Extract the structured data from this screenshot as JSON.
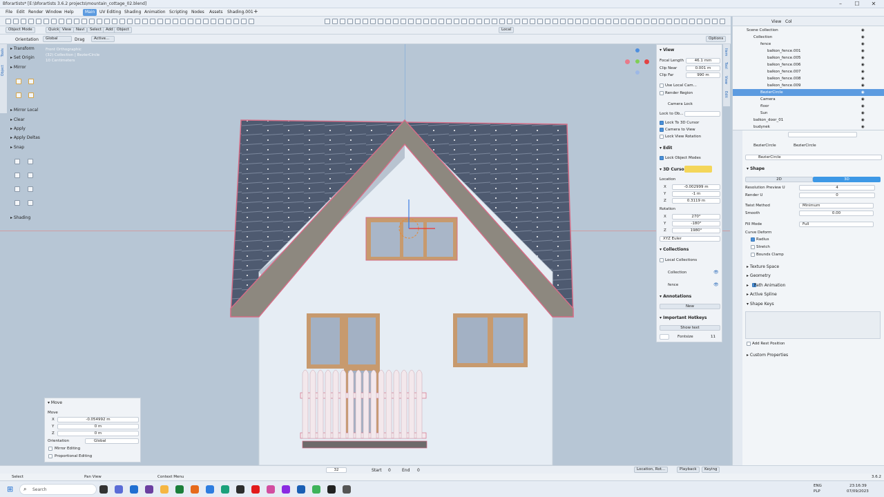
{
  "window": {
    "title": "Bforartists* [E:\\bforartists 3.6.2 projects\\mountain_cottage_02.blend]"
  },
  "top_menu": {
    "items": [
      "File",
      "Edit",
      "Render",
      "Window",
      "Help"
    ],
    "tabs": [
      "Main",
      "UV Editing",
      "Shading",
      "Animation",
      "Scripting",
      "Nodes",
      "Assets",
      "Shading.001"
    ],
    "active_tab": "Main"
  },
  "viewport_header": {
    "mode": "Object Mode",
    "buttons": [
      "Quick",
      "View",
      "Navi",
      "Select",
      "Add",
      "Object"
    ],
    "local": "Local",
    "options": "Options"
  },
  "tool_header": {
    "orientation_label": "Orientation",
    "orientation_value": "Global",
    "drag_label": "Drag",
    "drag_value": "Active..."
  },
  "viewport_info": {
    "line1": "Front Orthographic",
    "line2": "(32) Collection | BezierCircle",
    "line3": "10 Centimeters"
  },
  "left_toolbar": {
    "tabs": [
      "Tools",
      "Object"
    ],
    "items": [
      "Transform",
      "Set Origin",
      "Mirror",
      "Mirror Local",
      "Clear",
      "Apply",
      "Apply Deltas",
      "Snap",
      "Shading"
    ]
  },
  "move_panel": {
    "title": "Move",
    "section": "Move",
    "x": "-0.054992 m",
    "y": "0 m",
    "z": "0 m",
    "orientation_label": "Orientation",
    "orientation_value": "Global",
    "mirror_editing": "Mirror Editing",
    "proportional_editing": "Proportional Editing"
  },
  "n_panel": {
    "tabs": [
      "Item",
      "Tool",
      "View",
      "Edit"
    ],
    "view_title": "View",
    "focal_length_label": "Focal Length",
    "focal_length": "46.1 mm",
    "clip_near_label": "Clip Near",
    "clip_near": "0.001 m",
    "clip_far_label": "Clip Far",
    "clip_far": "990 m",
    "use_local_cam": "Use Local Cam...",
    "render_region": "Render Region",
    "camera_lock": "Camera Lock",
    "lock_to_obj": "Lock to Ob...",
    "lock_3d_cursor": "Lock To 3D Cursor",
    "camera_to_view": "Camera to View",
    "lock_view_rotation": "Lock View Rotation",
    "edit_title": "Edit",
    "lock_object_modes": "Lock Object Modes",
    "cursor_title": "3D Cursor",
    "location_label": "Location",
    "loc_x": "-0.002999 m",
    "loc_y": "-1 m",
    "loc_z": "0.3119 m",
    "rotation_label": "Rotation",
    "rot_x": "270°",
    "rot_y": "-180°",
    "rot_z": "1980°",
    "rot_mode": "XYZ Euler",
    "collections_title": "Collections",
    "local_collections": "Local Collections",
    "collection": "Collection",
    "fence": "fence",
    "annotations_title": "Annotations",
    "new_btn": "New",
    "hotkeys_title": "Important Hotkeys",
    "show_text": "Show text",
    "fontsize_label": "Fontsize",
    "fontsize": "11"
  },
  "outliner": {
    "header_view": "View",
    "header_col": "Col",
    "rows": [
      {
        "label": "Scene Collection",
        "indent": 0
      },
      {
        "label": "Collection",
        "indent": 1
      },
      {
        "label": "fence",
        "indent": 2
      },
      {
        "label": "balkon_fence.001",
        "indent": 3
      },
      {
        "label": "balkon_fence.005",
        "indent": 3
      },
      {
        "label": "balkon_fence.006",
        "indent": 3
      },
      {
        "label": "balkon_fence.007",
        "indent": 3
      },
      {
        "label": "balkon_fence.008",
        "indent": 3
      },
      {
        "label": "balkon_fence.009",
        "indent": 3
      },
      {
        "label": "BezierCircle",
        "indent": 2
      },
      {
        "label": "Camera",
        "indent": 2
      },
      {
        "label": "floor",
        "indent": 2
      },
      {
        "label": "Sun",
        "indent": 2
      },
      {
        "label": "balkon_door_01",
        "indent": 1
      },
      {
        "label": "budynek",
        "indent": 1
      }
    ],
    "selected": "BezierCircle"
  },
  "properties": {
    "object_name": "BezierCircle",
    "data_name": "BezierCircle",
    "datablock": "BezierCircle",
    "shape_title": "Shape",
    "dim_2d": "2D",
    "dim_3d": "3D",
    "res_preview_label": "Resolution Preview U",
    "res_preview": "4",
    "render_u_label": "Render U",
    "render_u": "0",
    "twist_method_label": "Twist Method",
    "twist_method": "Minimum",
    "smooth_label": "Smooth",
    "smooth": "0.00",
    "fill_mode_label": "Fill Mode",
    "fill_mode": "Full",
    "curve_deform": "Curve Deform",
    "radius": "Radius",
    "stretch": "Stretch",
    "bounds_clamp": "Bounds Clamp",
    "texture_space": "Texture Space",
    "geometry": "Geometry",
    "path_animation": "Path Animation",
    "active_spline": "Active Spline",
    "shape_keys": "Shape Keys",
    "add_rest_position": "Add Rest Position",
    "custom_properties": "Custom Properties"
  },
  "timeline": {
    "frame": "32",
    "start_label": "Start",
    "start": "0",
    "end_label": "End",
    "end": "0",
    "keying_set": "Location, Rot...",
    "playback": "Playback",
    "keying": "Keying"
  },
  "statusbar": {
    "select": "Select",
    "pan_view": "Pan View",
    "context_menu": "Context Menu",
    "version": "3.6.2"
  },
  "taskbar": {
    "search": "Search",
    "lang1": "ENG",
    "lang2": "PLP",
    "time": "23:16:39",
    "date": "07/09/2023"
  }
}
